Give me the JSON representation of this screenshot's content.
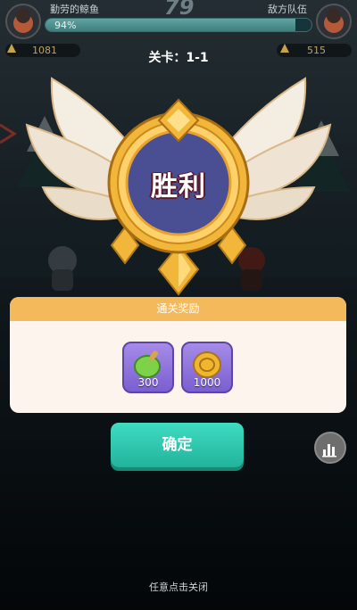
{
  "hud": {
    "left_name": "勤劳的鲸鱼",
    "right_name": "敌方队伍",
    "score": "79",
    "hp_percent_text": "94%",
    "hp_fraction": 0.94,
    "left_resource": "1081",
    "right_resource": "515"
  },
  "stage": {
    "label": "关卡：1-1"
  },
  "result": {
    "title": "胜利"
  },
  "rewards": {
    "header": "通关奖励",
    "items": [
      {
        "icon": "green-potion-icon",
        "count": "300"
      },
      {
        "icon": "gold-coin-icon",
        "count": "1000"
      }
    ]
  },
  "actions": {
    "confirm_label": "确定",
    "close_hint": "任意点击关闭"
  },
  "colors": {
    "reward_header": "#f3b95a",
    "confirm_button": "#2ecbb1",
    "reward_slot": "#8f74e0",
    "emblem_gold": "#f2b63a",
    "emblem_center": "#4a4f93"
  }
}
